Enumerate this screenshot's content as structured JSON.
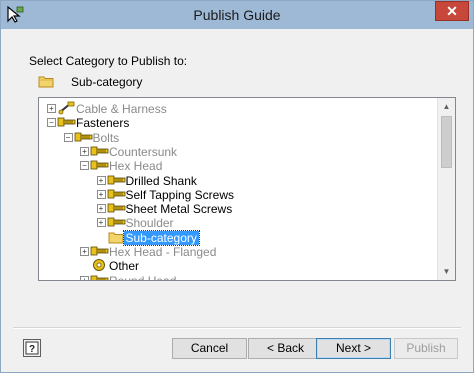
{
  "window": {
    "title": "Publish Guide"
  },
  "prompt": "Select Category to Publish to:",
  "selected_category": "Sub-category",
  "tree": [
    {
      "label": "Cable & Harness",
      "state": "collapsed",
      "icon": "cable-icon",
      "greyed": true
    },
    {
      "label": "Fasteners",
      "state": "expanded",
      "icon": "bolt-icon",
      "greyed": false
    },
    {
      "label": "Bolts",
      "state": "expanded",
      "icon": "bolt-icon",
      "greyed": true
    },
    {
      "label": "Countersunk",
      "state": "collapsed",
      "icon": "bolt-icon",
      "greyed": true
    },
    {
      "label": "Hex Head",
      "state": "expanded",
      "icon": "bolt-icon",
      "greyed": true
    },
    {
      "label": "Drilled Shank",
      "state": "collapsed",
      "icon": "bolt-icon",
      "greyed": false
    },
    {
      "label": "Self Tapping Screws",
      "state": "collapsed",
      "icon": "bolt-icon",
      "greyed": false
    },
    {
      "label": "Sheet Metal Screws",
      "state": "collapsed",
      "icon": "bolt-icon",
      "greyed": false
    },
    {
      "label": "Shoulder",
      "state": "collapsed",
      "icon": "bolt-icon",
      "greyed": true
    },
    {
      "label": "Sub-category",
      "state": "leaf",
      "icon": "folder-icon",
      "greyed": false,
      "selected": true
    },
    {
      "label": "Hex Head - Flanged",
      "state": "collapsed",
      "icon": "bolt-icon",
      "greyed": true
    },
    {
      "label": "Other",
      "state": "leaf",
      "icon": "washer-icon",
      "greyed": false
    },
    {
      "label": "Round Head",
      "state": "collapsed",
      "icon": "bolt-icon",
      "greyed": true
    }
  ],
  "buttons": {
    "help": "?",
    "cancel": "Cancel",
    "back": "< Back",
    "next": "Next >",
    "publish": "Publish"
  },
  "colors": {
    "titlebar": "#9eb9d6",
    "close": "#c7473a",
    "selection": "#3399ff",
    "bolt": "#e8c21a"
  }
}
